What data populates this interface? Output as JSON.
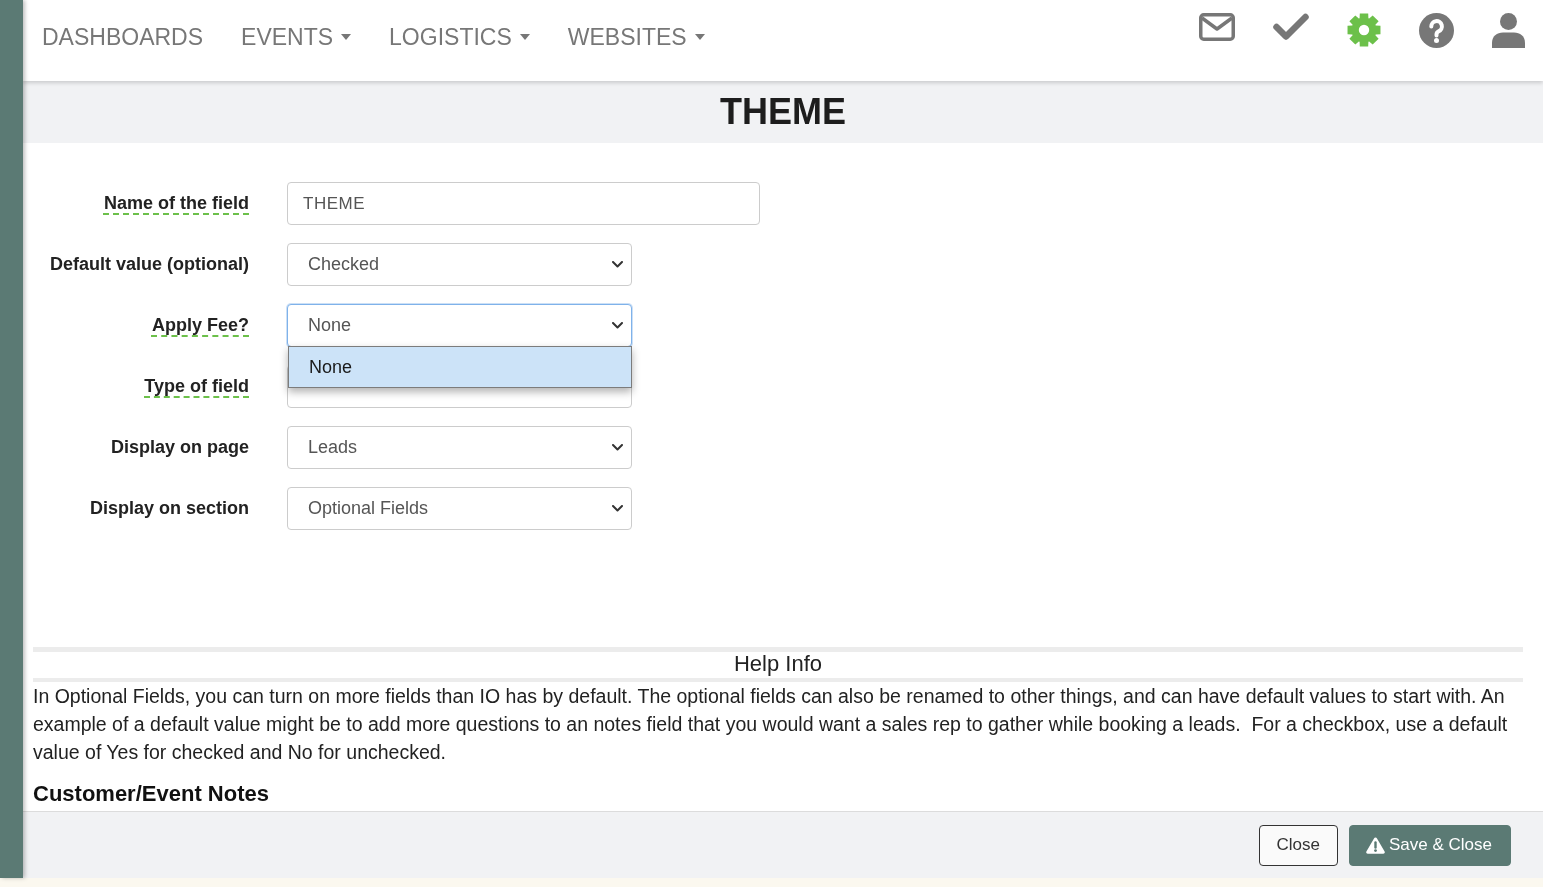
{
  "navbar": {
    "items": [
      {
        "label": "DASHBOARDS",
        "dropdown": false
      },
      {
        "label": "EVENTS",
        "dropdown": true
      },
      {
        "label": "LOGISTICS",
        "dropdown": true
      },
      {
        "label": "WEBSITES",
        "dropdown": true
      }
    ]
  },
  "toolbar_icons": [
    {
      "selected": false
    },
    {
      "selected": false
    },
    {
      "selected": true
    },
    {
      "selected": false
    },
    {
      "selected": false
    }
  ],
  "dialog": {
    "title": "THEME",
    "fields": [
      {
        "label": "Name of the field",
        "tooltip": true,
        "kind": "text",
        "value": "THEME"
      },
      {
        "label": "Default value (optional)",
        "tooltip": false,
        "kind": "select",
        "expanded": false,
        "value": "Checked"
      },
      {
        "label": "Apply Fee?",
        "tooltip": true,
        "kind": "select",
        "expanded": true,
        "value": "None",
        "options": [
          {
            "label": "None",
            "selected": true
          }
        ]
      },
      {
        "label": "Type of field",
        "tooltip": true,
        "kind": "select",
        "expanded": false
      },
      {
        "label": "Display on page",
        "tooltip": false,
        "kind": "select",
        "expanded": false,
        "value": "Leads"
      },
      {
        "label": "Display on section",
        "tooltip": false,
        "kind": "select",
        "expanded": false,
        "value": "Optional Fields"
      }
    ],
    "help": {
      "title": "Help Info",
      "text": "In Optional Fields, you can turn on more fields than IO has by default. The optional fields can also be renamed to other things, and can have default values to start with. An example of a default value might be to add more questions to an notes field that you would want a sales rep to gather while booking a leads.  For a checkbox, use a default value of Yes for checked and No for unchecked."
    },
    "section_heading": "Customer/Event Notes",
    "buttons": [
      {
        "label": "Close",
        "kind": "secondary"
      },
      {
        "label": "Save & Close",
        "kind": "primary"
      }
    ]
  }
}
